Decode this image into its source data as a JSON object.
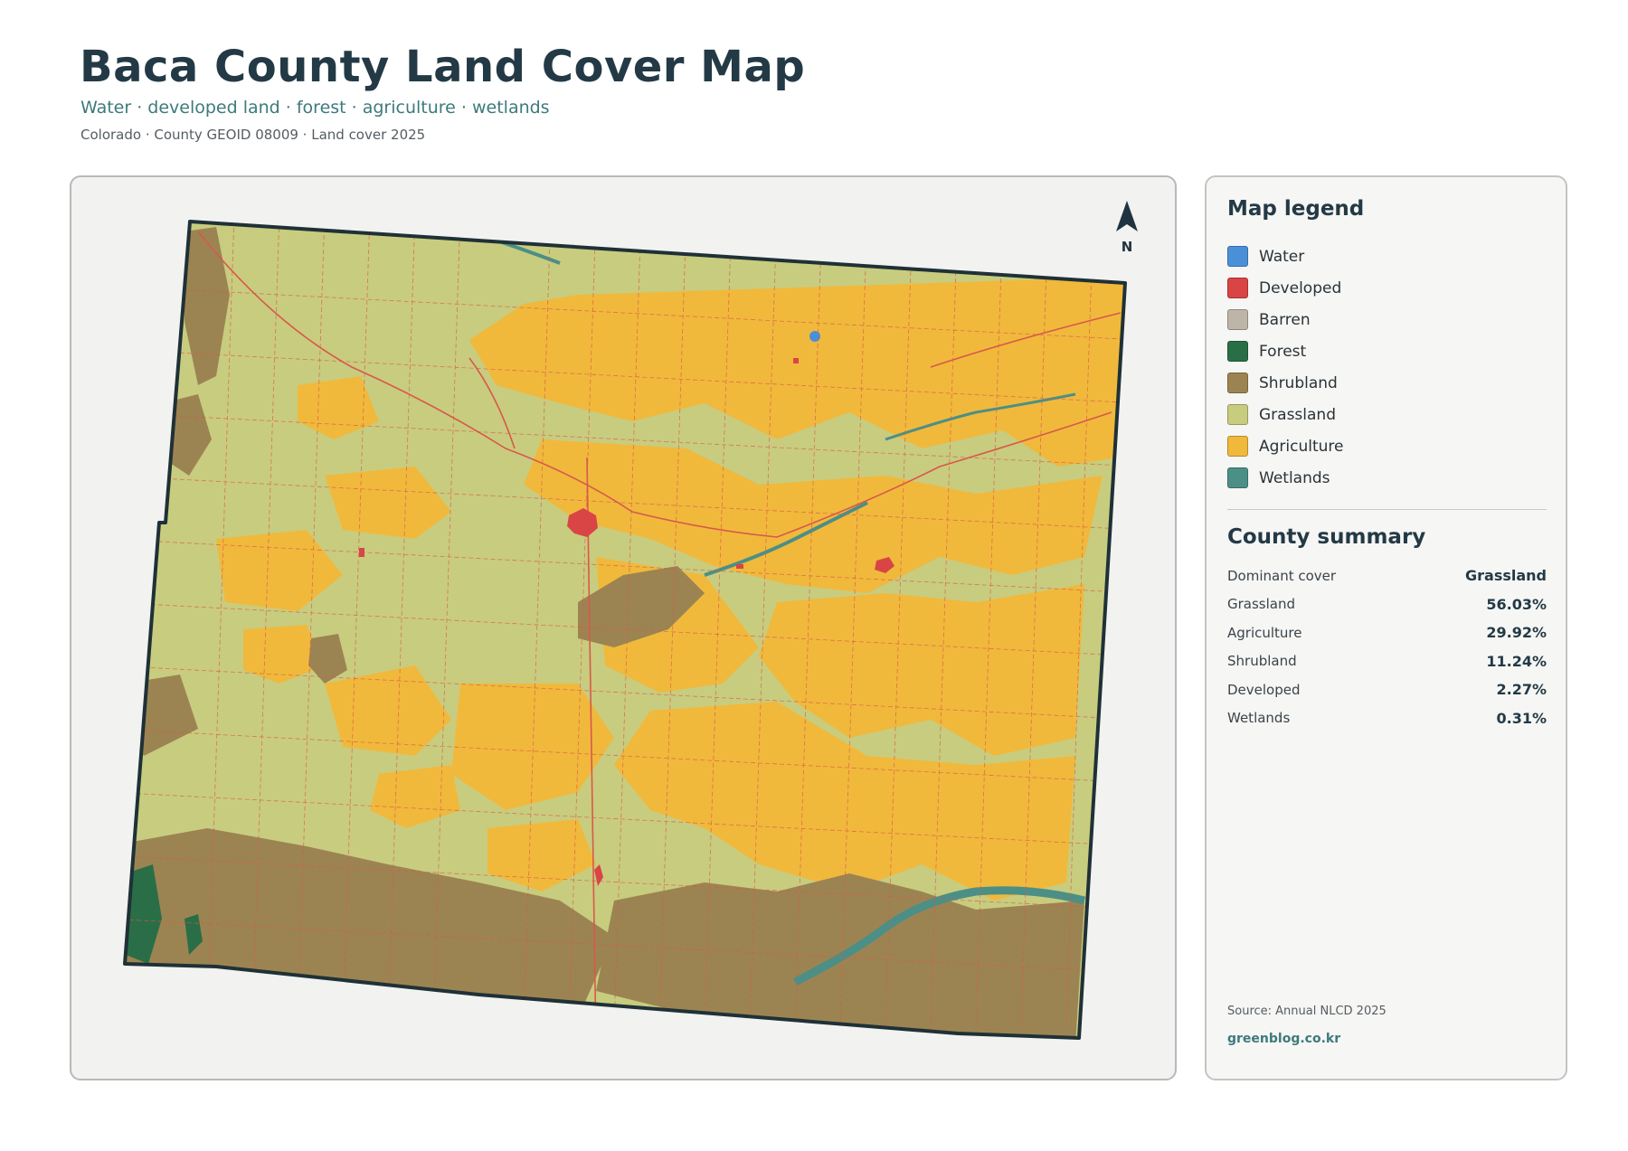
{
  "header": {
    "title": "Baca County Land Cover Map",
    "subtitle": "Water · developed land · forest · agriculture · wetlands",
    "meta": "Colorado · County GEOID 08009 · Land cover 2025"
  },
  "map": {
    "north_label": "N",
    "colors": {
      "water": "#4a90d9",
      "developed": "#d94545",
      "barren": "#bdb6a8",
      "forest": "#2a6e47",
      "shrubland": "#9c8452",
      "grassland": "#c8cc7f",
      "agriculture": "#f0b93c",
      "wetlands": "#4c8f86",
      "roads": "#d9584a",
      "outline": "#1f3137"
    }
  },
  "legend": {
    "title": "Map legend",
    "items": [
      {
        "label": "Water",
        "color": "#4a90d9"
      },
      {
        "label": "Developed",
        "color": "#d94545"
      },
      {
        "label": "Barren",
        "color": "#bdb6a8"
      },
      {
        "label": "Forest",
        "color": "#2a6e47"
      },
      {
        "label": "Shrubland",
        "color": "#9c8452"
      },
      {
        "label": "Grassland",
        "color": "#c8cc7f"
      },
      {
        "label": "Agriculture",
        "color": "#f0b93c"
      },
      {
        "label": "Wetlands",
        "color": "#4c8f86"
      }
    ]
  },
  "summary": {
    "title": "County summary",
    "rows": [
      {
        "label": "Dominant cover",
        "value": "Grassland"
      },
      {
        "label": "Grassland",
        "value": "56.03%"
      },
      {
        "label": "Agriculture",
        "value": "29.92%"
      },
      {
        "label": "Shrubland",
        "value": "11.24%"
      },
      {
        "label": "Developed",
        "value": "2.27%"
      },
      {
        "label": "Wetlands",
        "value": "0.31%"
      }
    ]
  },
  "footer": {
    "source": "Source: Annual NLCD 2025",
    "site": "greenblog.co.kr"
  }
}
